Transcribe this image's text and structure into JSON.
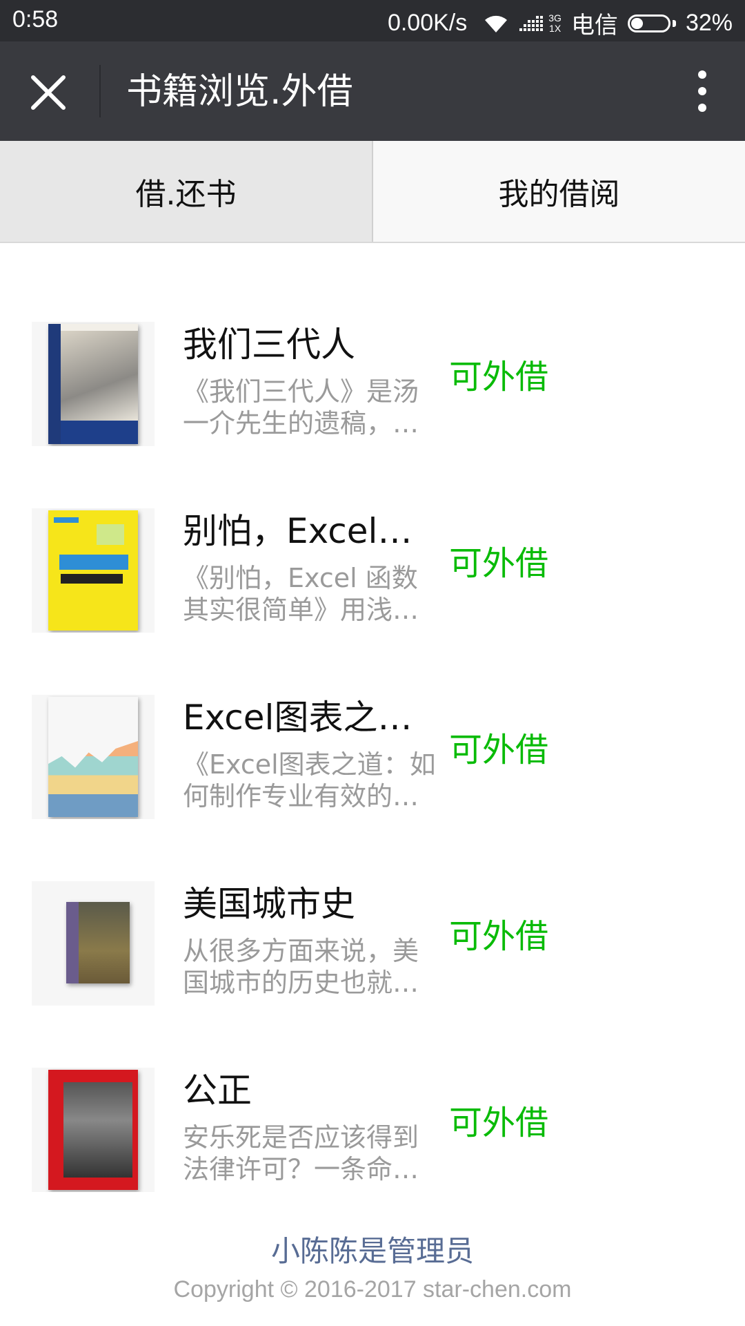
{
  "status_bar": {
    "time": "0:58",
    "speed": "0.00K/s",
    "net_top": "3G",
    "net_bottom": "1X",
    "carrier": "电信",
    "battery": "32%",
    "battery_level": 0.32
  },
  "header": {
    "title": "书籍浏览.外借",
    "close_icon": "close-icon",
    "more_icon": "more-vertical-icon"
  },
  "tabs": [
    {
      "label": "借.还书"
    },
    {
      "label": "我的借阅"
    }
  ],
  "books": [
    {
      "title": "我们三代人",
      "description": "《我们三代人》是汤一介先生的遗稿，经整理而成",
      "status": "可外借"
    },
    {
      "title": "别怕，Excel函数其实很简单",
      "description": "《别怕，Excel 函数其实很简单》用浅显易懂的语言",
      "status": "可外借"
    },
    {
      "title": "Excel图表之道：如何制作专业有效的商务图表",
      "description": "《Excel图表之道：如何制作专业有效的商务图表》",
      "status": "可外借"
    },
    {
      "title": "美国城市史",
      "description": "从很多方面来说，美国城市的历史也就是美国的历史",
      "status": "可外借"
    },
    {
      "title": "公正",
      "description": "安乐死是否应该得到法律许可？一条命是否值得",
      "status": "可外借"
    }
  ],
  "footer": {
    "admin": "小陈陈是管理员",
    "copyright": "Copyright © 2016-2017 star-chen.com"
  },
  "colors": {
    "available": "#09bb07",
    "header_bg": "#393a3f",
    "link": "#586c94"
  }
}
